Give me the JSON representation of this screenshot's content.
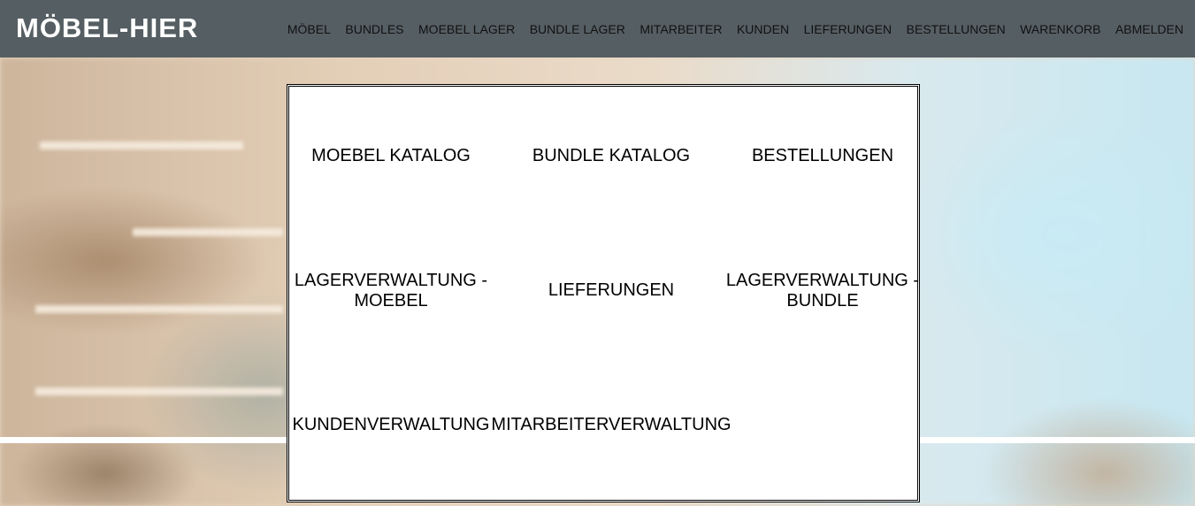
{
  "header": {
    "logo": "MÖBEL-HIER",
    "nav": [
      "MÖBEL",
      "BUNDLES",
      "MOEBEL LAGER",
      "BUNDLE LAGER",
      "MITARBEITER",
      "KUNDEN",
      "LIEFERUNGEN",
      "BESTELLUNGEN",
      "WARENKORB",
      "ABMELDEN"
    ]
  },
  "menu": {
    "moebel_katalog": "MOEBEL KATALOG",
    "bundle_katalog": "BUNDLE KATALOG",
    "bestellungen": "BESTELLUNGEN",
    "lager_moebel": "LAGERVERWALTUNG - MOEBEL",
    "lieferungen": "LIEFERUNGEN",
    "lager_bundle": "LAGERVERWALTUNG - BUNDLE",
    "kunden": "KUNDENVERWALTUNG",
    "mitarbeiter": "MITARBEITERVERWALTUNG"
  }
}
